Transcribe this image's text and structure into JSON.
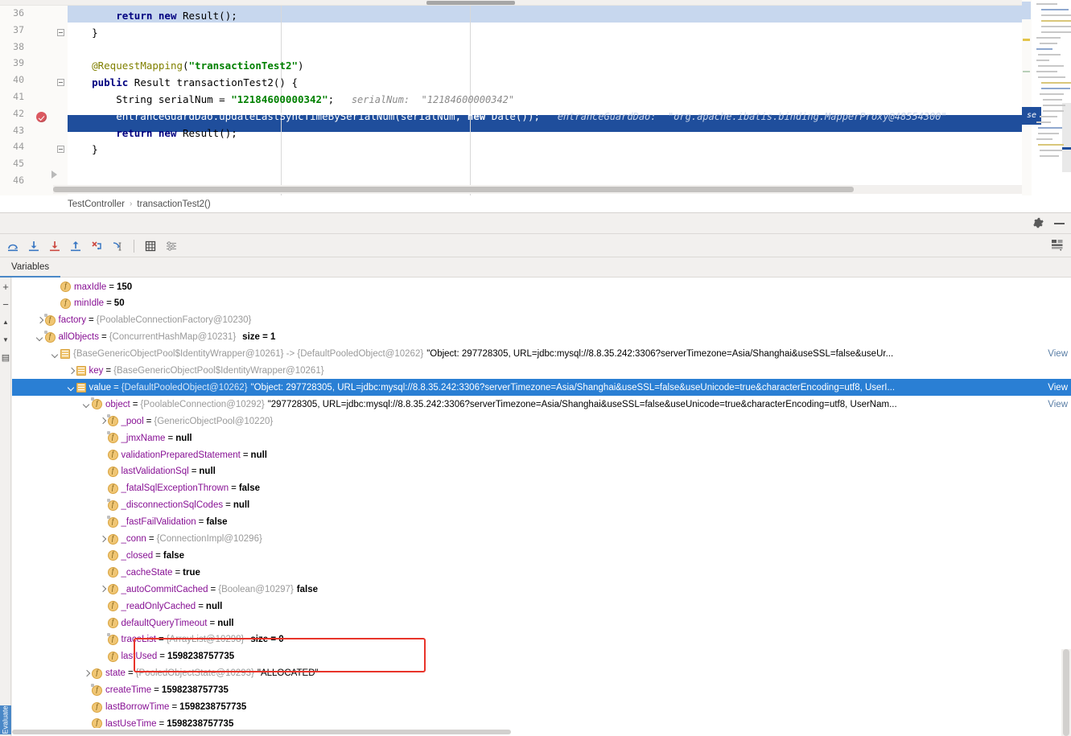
{
  "editor": {
    "line_numbers": [
      "36",
      "37",
      "38",
      "39",
      "40",
      "41",
      "42",
      "43",
      "44",
      "45",
      "46"
    ],
    "lines": [
      {
        "num": "36",
        "segments": [
          {
            "t": "        ",
            "c": "plain"
          },
          {
            "t": "return",
            "c": "kw"
          },
          {
            "t": " ",
            "c": "plain"
          },
          {
            "t": "new",
            "c": "kw"
          },
          {
            "t": " Result();",
            "c": "plain"
          }
        ]
      },
      {
        "num": "37",
        "segments": [
          {
            "t": "    }",
            "c": "plain"
          }
        ]
      },
      {
        "num": "38",
        "segments": [
          {
            "t": "",
            "c": "plain"
          }
        ]
      },
      {
        "num": "39",
        "segments": [
          {
            "t": "    ",
            "c": "plain"
          },
          {
            "t": "@RequestMapping",
            "c": "ann"
          },
          {
            "t": "(",
            "c": "plain"
          },
          {
            "t": "\"transactionTest2\"",
            "c": "str"
          },
          {
            "t": ")",
            "c": "plain"
          }
        ]
      },
      {
        "num": "40",
        "segments": [
          {
            "t": "    ",
            "c": "plain"
          },
          {
            "t": "public",
            "c": "kw"
          },
          {
            "t": " Result transactionTest2() {",
            "c": "plain"
          }
        ]
      },
      {
        "num": "41",
        "segments": [
          {
            "t": "        String serialNum = ",
            "c": "plain"
          },
          {
            "t": "\"12184600000342\"",
            "c": "str"
          },
          {
            "t": ";",
            "c": "plain"
          }
        ]
      },
      {
        "num": "42",
        "segments": [
          {
            "t": "        entranceGuardDao.updateLastSyncTimeBySerialNum(serialNum, ",
            "c": "on-blue"
          },
          {
            "t": "new",
            "c": "on-blue-kw"
          },
          {
            "t": " Date());",
            "c": "on-blue"
          }
        ]
      },
      {
        "num": "43",
        "segments": [
          {
            "t": "        ",
            "c": "plain"
          },
          {
            "t": "return",
            "c": "kw"
          },
          {
            "t": " ",
            "c": "plain"
          },
          {
            "t": "new",
            "c": "kw"
          },
          {
            "t": " Result();",
            "c": "plain"
          }
        ]
      },
      {
        "num": "44",
        "segments": [
          {
            "t": "    }",
            "c": "plain"
          }
        ]
      },
      {
        "num": "45",
        "segments": [
          {
            "t": "",
            "c": "plain"
          }
        ]
      },
      {
        "num": "46",
        "segments": [
          {
            "t": "",
            "c": "plain"
          }
        ]
      }
    ],
    "inline_hint_line41": "serialNum:  \"12184600000342\"",
    "inline_hint_line42": "entranceGuardDao:  \"org.apache.ibatis.binding.MapperProxy@48554300\"",
    "inline_hint_line42_tail": "se",
    "breakpoint_line": "42",
    "highlight_line": "42"
  },
  "breadcrumb": {
    "class": "TestController",
    "separator": "›",
    "method": "transactionTest2()"
  },
  "debug_toolbar": {
    "buttons": [
      {
        "name": "step-over-button",
        "title": "Step Over"
      },
      {
        "name": "step-into-button",
        "title": "Step Into"
      },
      {
        "name": "force-step-into-button",
        "title": "Force Step Into"
      },
      {
        "name": "step-out-button",
        "title": "Step Out"
      },
      {
        "name": "drop-frame-button",
        "title": "Drop Frame"
      },
      {
        "name": "run-to-cursor-button",
        "title": "Run to Cursor"
      },
      {
        "name": "evaluate-expression-button",
        "title": "Evaluate Expression"
      },
      {
        "name": "settings-filter-button",
        "title": "Settings"
      }
    ],
    "gear_title": "Settings",
    "minimize_title": "Hide",
    "layout_title": "Restore Layout"
  },
  "tabs": [
    {
      "label": "Variables",
      "active": true
    }
  ],
  "left_rail": {
    "add_label": "+",
    "remove_label": "−",
    "up_label": "▲",
    "down_label": "▼",
    "copy_label": "▤",
    "evaluate_label": "Evaluate"
  },
  "variables": [
    {
      "indent": 6,
      "twisty": "none",
      "icon": "field",
      "final": false,
      "name": "maxIdle",
      "eq": "=",
      "type": "",
      "value": "150",
      "size": "",
      "link": ""
    },
    {
      "indent": 6,
      "twisty": "none",
      "icon": "field",
      "final": false,
      "name": "minIdle",
      "eq": "=",
      "type": "",
      "value": "50",
      "size": "",
      "link": ""
    },
    {
      "indent": 5,
      "twisty": "closed",
      "icon": "field",
      "final": true,
      "name": "factory",
      "eq": "=",
      "type": "{PoolableConnectionFactory@10230}",
      "value": "",
      "size": "",
      "link": ""
    },
    {
      "indent": 5,
      "twisty": "open",
      "icon": "field",
      "final": true,
      "name": "allObjects",
      "eq": "=",
      "type": "{ConcurrentHashMap@10231}",
      "value": "",
      "size": "size = 1",
      "link": ""
    },
    {
      "indent": 6,
      "twisty": "open",
      "icon": "entry",
      "final": false,
      "name": "",
      "eq": "",
      "type": "{BaseGenericObjectPool$IdentityWrapper@10261}  -> {DefaultPooledObject@10262}",
      "value": "\"Object: 297728305, URL=jdbc:mysql://8.8.35.242:3306?serverTimezone=Asia/Shanghai&useSSL=false&useUr...",
      "size": "",
      "link": "View"
    },
    {
      "indent": 7,
      "twisty": "closed",
      "icon": "entry",
      "final": false,
      "name": "key",
      "eq": "=",
      "type": "{BaseGenericObjectPool$IdentityWrapper@10261}",
      "value": "",
      "size": "",
      "link": ""
    },
    {
      "indent": 7,
      "twisty": "open",
      "icon": "entry",
      "final": false,
      "name": "value",
      "eq": "=",
      "type": "{DefaultPooledObject@10262}",
      "value": "\"Object: 297728305, URL=jdbc:mysql://8.8.35.242:3306?serverTimezone=Asia/Shanghai&useSSL=false&useUnicode=true&characterEncoding=utf8, UserI...",
      "size": "",
      "link": "View",
      "selected": true
    },
    {
      "indent": 8,
      "twisty": "open",
      "icon": "field",
      "final": true,
      "name": "object",
      "eq": "=",
      "type": "{PoolableConnection@10292}",
      "value": "\"297728305, URL=jdbc:mysql://8.8.35.242:3306?serverTimezone=Asia/Shanghai&useSSL=false&useUnicode=true&characterEncoding=utf8, UserNam...",
      "size": "",
      "link": "View"
    },
    {
      "indent": 9,
      "twisty": "closed",
      "icon": "field",
      "final": true,
      "name": "_pool",
      "eq": "=",
      "type": "{GenericObjectPool@10220}",
      "value": "",
      "size": "",
      "link": ""
    },
    {
      "indent": 9,
      "twisty": "none",
      "icon": "field",
      "final": true,
      "name": "_jmxName",
      "eq": "=",
      "type": "",
      "value": "null",
      "size": "",
      "link": ""
    },
    {
      "indent": 9,
      "twisty": "none",
      "icon": "field",
      "final": false,
      "name": "validationPreparedStatement",
      "eq": "=",
      "type": "",
      "value": "null",
      "size": "",
      "link": ""
    },
    {
      "indent": 9,
      "twisty": "none",
      "icon": "field",
      "final": false,
      "name": "lastValidationSql",
      "eq": "=",
      "type": "",
      "value": "null",
      "size": "",
      "link": ""
    },
    {
      "indent": 9,
      "twisty": "none",
      "icon": "field",
      "final": false,
      "name": "_fatalSqlExceptionThrown",
      "eq": "=",
      "type": "",
      "value": "false",
      "size": "",
      "link": ""
    },
    {
      "indent": 9,
      "twisty": "none",
      "icon": "field",
      "final": true,
      "name": "_disconnectionSqlCodes",
      "eq": "=",
      "type": "",
      "value": "null",
      "size": "",
      "link": ""
    },
    {
      "indent": 9,
      "twisty": "none",
      "icon": "field",
      "final": true,
      "name": "_fastFailValidation",
      "eq": "=",
      "type": "",
      "value": "false",
      "size": "",
      "link": ""
    },
    {
      "indent": 9,
      "twisty": "closed",
      "icon": "field",
      "final": false,
      "name": "_conn",
      "eq": "=",
      "type": "{ConnectionImpl@10296}",
      "value": "",
      "size": "",
      "link": ""
    },
    {
      "indent": 9,
      "twisty": "none",
      "icon": "field",
      "final": false,
      "name": "_closed",
      "eq": "=",
      "type": "",
      "value": "false",
      "size": "",
      "link": ""
    },
    {
      "indent": 9,
      "twisty": "none",
      "icon": "field",
      "final": false,
      "name": "_cacheState",
      "eq": "=",
      "type": "",
      "value": "true",
      "size": "",
      "link": ""
    },
    {
      "indent": 9,
      "twisty": "closed",
      "icon": "field",
      "final": false,
      "name": "_autoCommitCached",
      "eq": "=",
      "type": "{Boolean@10297}",
      "value": "false",
      "size": "",
      "link": "",
      "boxed": true
    },
    {
      "indent": 9,
      "twisty": "none",
      "icon": "field",
      "final": false,
      "name": "_readOnlyCached",
      "eq": "=",
      "type": "",
      "value": "null",
      "size": "",
      "link": ""
    },
    {
      "indent": 9,
      "twisty": "none",
      "icon": "field",
      "final": false,
      "name": "defaultQueryTimeout",
      "eq": "=",
      "type": "",
      "value": "null",
      "size": "",
      "link": ""
    },
    {
      "indent": 9,
      "twisty": "none",
      "icon": "field",
      "final": true,
      "name": "traceList",
      "eq": "=",
      "type": "{ArrayList@10298}",
      "value": "",
      "size": "size = 0",
      "link": ""
    },
    {
      "indent": 9,
      "twisty": "none",
      "icon": "field",
      "final": false,
      "name": "lastUsed",
      "eq": "=",
      "type": "",
      "value": "1598238757735",
      "size": "",
      "link": ""
    },
    {
      "indent": 8,
      "twisty": "closed",
      "icon": "field",
      "final": false,
      "name": "state",
      "eq": "=",
      "type": "{PooledObjectState@10293}",
      "value": "\"ALLOCATED\"",
      "size": "",
      "link": ""
    },
    {
      "indent": 8,
      "twisty": "none",
      "icon": "field",
      "final": true,
      "name": "createTime",
      "eq": "=",
      "type": "",
      "value": "1598238757735",
      "size": "",
      "link": ""
    },
    {
      "indent": 8,
      "twisty": "none",
      "icon": "field",
      "final": false,
      "name": "lastBorrowTime",
      "eq": "=",
      "type": "",
      "value": "1598238757735",
      "size": "",
      "link": ""
    },
    {
      "indent": 8,
      "twisty": "none",
      "icon": "field",
      "final": false,
      "name": "lastUseTime",
      "eq": "=",
      "type": "",
      "value": "1598238757735",
      "size": "",
      "link": ""
    }
  ],
  "annotation": {
    "highlight_box_target": "_autoCommitCached",
    "highlight_box_color": "#e8342a"
  },
  "colors": {
    "selection_blue": "#2a7fd4",
    "code_highlight_blue": "#1f4e9c",
    "caret_row_blue": "#c7d7ee",
    "field_icon": "#f0c674",
    "name_purple": "#871094",
    "keyword_navy": "#000080",
    "string_green": "#008000",
    "annotation_olive": "#808000",
    "breakpoint_red": "#db5860"
  }
}
